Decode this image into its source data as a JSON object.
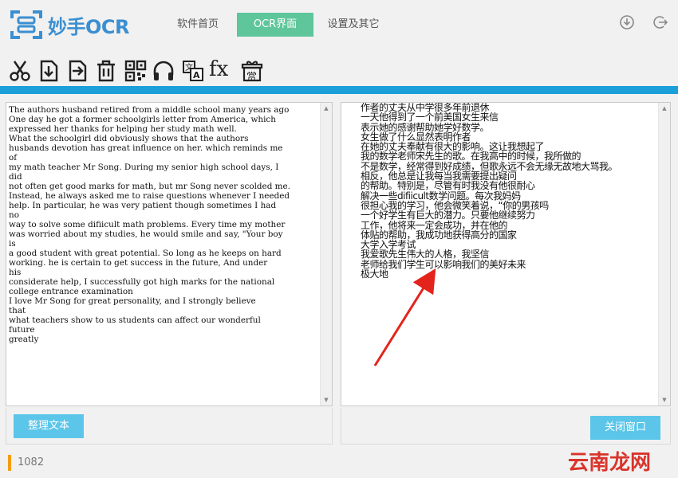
{
  "app": {
    "title": "妙手OCR"
  },
  "nav": {
    "home": "软件首页",
    "ocr": "OCR界面",
    "settings": "设置及其它"
  },
  "toolbar": {
    "icons": [
      "scissors-icon",
      "import-icon",
      "export-icon",
      "trash-icon",
      "qrcode-icon",
      "headphones-icon",
      "translate-icon",
      "formula-icon",
      "gift-icon"
    ],
    "fx_label": "fx",
    "gift_label": "赏"
  },
  "left_text": {
    "lines": [
      "The authors husband retired from a middle school many years ago",
      "One day he got a former schoolgirls letter from America, which",
      "expressed her thanks for helping her study math well.",
      "What the schoolgirl did obviously shows that the authors",
      "husbands devotion has great influence on her. which reminds me",
      "of",
      "my math teacher Mr Song. During my senior high school days, I",
      "did",
      "not often get good marks for math, but mr Song never scolded me.",
      "Instead, he always asked me to raise questions whenever I needed",
      "help. In particular, he was very patient though sometimes I had",
      "no",
      "way to solve some difiicult math problems. Every time my mother",
      "was worried about my studies, he would smile and say, \"Your boy",
      "is",
      "a good student with great potential. So long as he keeps on hard",
      "working. he is certain to get success in the future, And under",
      "his",
      "considerate help, I successfully got high marks for the national",
      "college entrance examination",
      "I love Mr Song for great personality, and I strongly believe",
      "that",
      "what teachers show to us students can affect our wonderful",
      "future",
      "greatly"
    ]
  },
  "right_text": {
    "lines": [
      "作者的丈夫从中学很多年前退休",
      "一天他得到了一个前美国女生来信",
      "表示她的感谢帮助她学好数学。",
      "女生做了什么显然表明作者",
      "在她的丈夫奉献有很大的影响。这让我想起了",
      "我的数学老师宋先生的歌。在我高中的时候，我所做的",
      "不是数学，经常得到好成绩，但歌永远不会无缘无故地大骂我。",
      "相反，他总是让我每当我需要提出疑问",
      "的帮助。特别是，尽管有时我没有他很耐心",
      "解决一些difiicult数学问题。每次我妈妈",
      "很担心我的学习，他会微笑着说，“你的男孩吗",
      "一个好学生有巨大的潜力。只要他继续努力",
      "工作，他将来一定会成功，并在他的",
      "体贴的帮助，我成功地获得高分的国家",
      "大学入学考试",
      "我爱歌先生伟大的人格，我坚信",
      "老师给我们学生可以影响我们的美好未来",
      "极大地"
    ]
  },
  "buttons": {
    "organize": "整理文本",
    "close": "关闭窗口"
  },
  "status": {
    "count": "1082"
  },
  "watermark": {
    "text": "云南龙网"
  },
  "colors": {
    "accent": "#5ec69a",
    "strip": "#1b9fd9",
    "button": "#5bc6e9",
    "arrow": "#e3241c"
  }
}
